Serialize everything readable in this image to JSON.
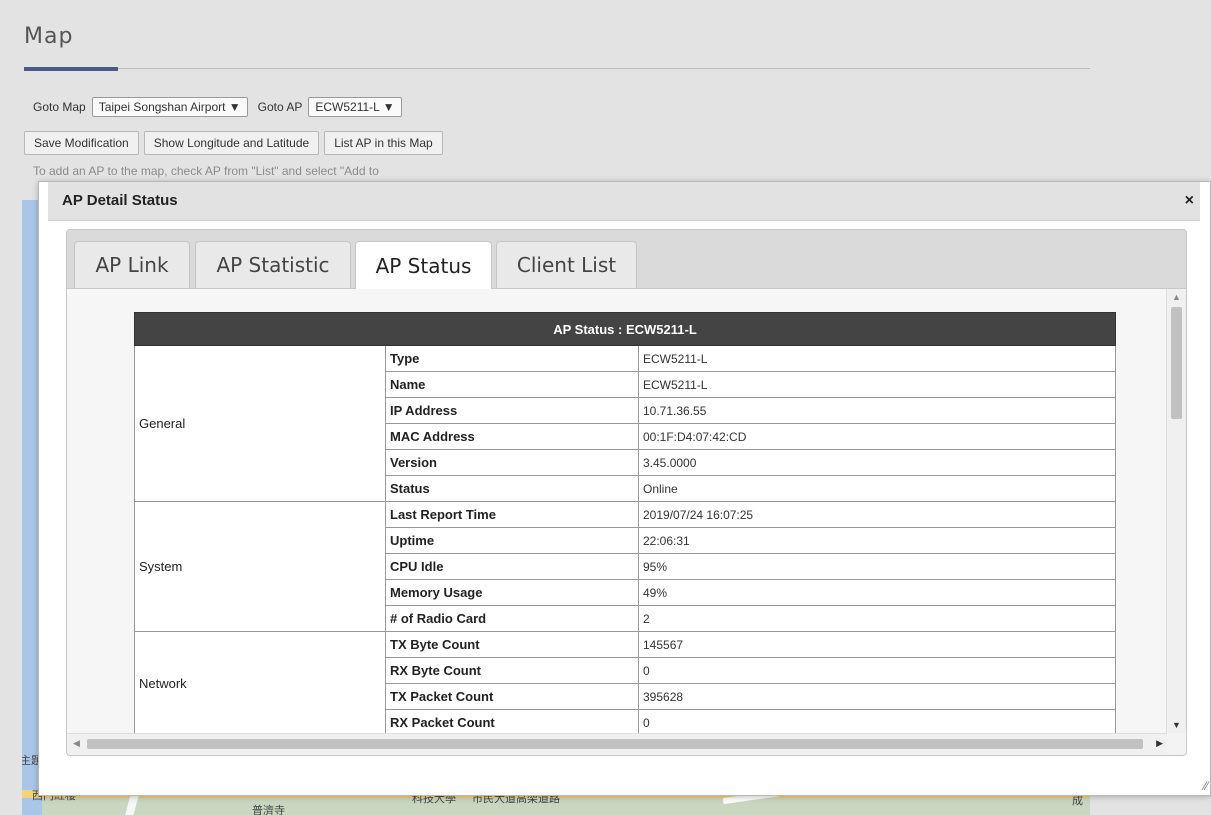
{
  "page": {
    "title": "Map",
    "goto_map_label": "Goto Map",
    "goto_map_value": "Taipei Songshan Airport ▼",
    "goto_ap_label": "Goto AP",
    "goto_ap_value": "ECW5211-L ▼",
    "buttons": {
      "save": "Save Modification",
      "show_lonlat": "Show Longitude and Latitude",
      "list_ap": "List AP in this Map"
    },
    "hint": "To add an AP to the map, check AP from \"List\" and select \"Add to"
  },
  "map_labels": {
    "l1": "西門紅樓",
    "l2": "普濟寺",
    "l3": "科技大學",
    "l4": "市民大道高架道路",
    "l5": "主題",
    "l6": "成"
  },
  "modal": {
    "title": "AP Detail Status",
    "close": "×",
    "resize": "⁄⁄",
    "tabs": {
      "ap_link": "AP Link",
      "ap_statistic": "AP Statistic",
      "ap_status": "AP Status",
      "client_list": "Client List"
    },
    "active_tab": "AP Status"
  },
  "status_table": {
    "header": "AP Status : ECW5211-L",
    "general": {
      "label": "General",
      "rows": [
        {
          "field": "Type",
          "value": "ECW5211-L"
        },
        {
          "field": "Name",
          "value": "ECW5211-L"
        },
        {
          "field": "IP Address",
          "value": "10.71.36.55"
        },
        {
          "field": "MAC Address",
          "value": "00:1F:D4:07:42:CD"
        },
        {
          "field": "Version",
          "value": "3.45.0000"
        },
        {
          "field": "Status",
          "value": "Online"
        }
      ]
    },
    "system": {
      "label": "System",
      "rows": [
        {
          "field": "Last Report Time",
          "value": "2019/07/24 16:07:25"
        },
        {
          "field": "Uptime",
          "value": "22:06:31"
        },
        {
          "field": "CPU Idle",
          "value": "95%"
        },
        {
          "field": "Memory Usage",
          "value": "49%"
        },
        {
          "field": "# of Radio Card",
          "value": "2"
        }
      ]
    },
    "network": {
      "label": "Network",
      "rows": [
        {
          "field": "TX Byte Count",
          "value": "145567"
        },
        {
          "field": "RX Byte Count",
          "value": "0"
        },
        {
          "field": "TX Packet Count",
          "value": "395628"
        },
        {
          "field": "RX Packet Count",
          "value": "0"
        }
      ]
    }
  },
  "colors": {
    "table_header_bg": "#444444",
    "title_accent": "#4a5a80",
    "modal_header_bg": "#e2e2e2"
  }
}
